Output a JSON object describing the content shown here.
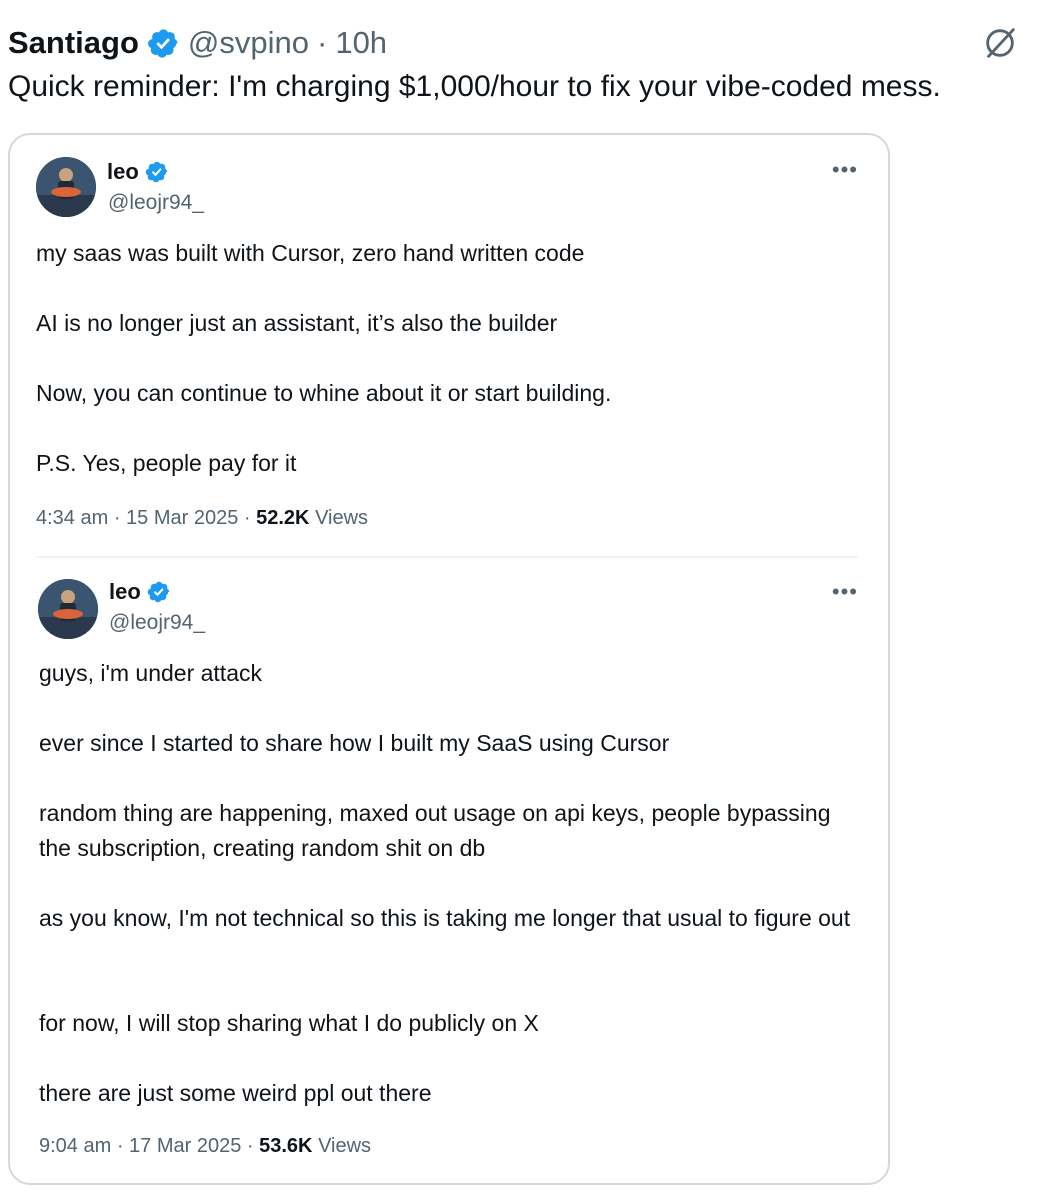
{
  "outer_tweet": {
    "author_name": "Santiago",
    "handle": "@svpino",
    "time": "10h",
    "text": "Quick reminder: I'm charging $1,000/hour to fix your vibe-coded mess.",
    "verified_icon": "verified-badge-icon",
    "grok_icon": "grok-icon"
  },
  "quoted_tweets": [
    {
      "author_name": "leo",
      "handle": "@leojr94_",
      "paragraphs": [
        "my saas was built with Cursor, zero hand written code",
        "AI is no longer just an assistant, it’s also the builder",
        "Now, you can continue to whine about it or start building.",
        "P.S. Yes, people pay for it"
      ],
      "time": "4:34 am",
      "date": "15 Mar 2025",
      "views_count": "52.2K",
      "views_label": "Views",
      "more_icon": "more-options-icon"
    },
    {
      "author_name": "leo",
      "handle": "@leojr94_",
      "paragraphs": [
        "guys, i'm under attack",
        "ever since I started to share how I built my SaaS using Cursor",
        "random thing are happening, maxed out usage on api keys, people bypassing the subscription, creating random shit on db",
        "as you know, I'm not technical so this is taking me longer that usual to figure out",
        "for now, I will stop sharing what I do publicly on X",
        "there are just some weird ppl out there"
      ],
      "time": "9:04 am",
      "date": "17 Mar 2025",
      "views_count": "53.6K",
      "views_label": "Views",
      "more_icon": "more-options-icon"
    }
  ],
  "colors": {
    "verified_blue": "#1d9bf0",
    "text_primary": "#0f1419",
    "text_secondary": "#536471",
    "border": "#cfd9de"
  }
}
